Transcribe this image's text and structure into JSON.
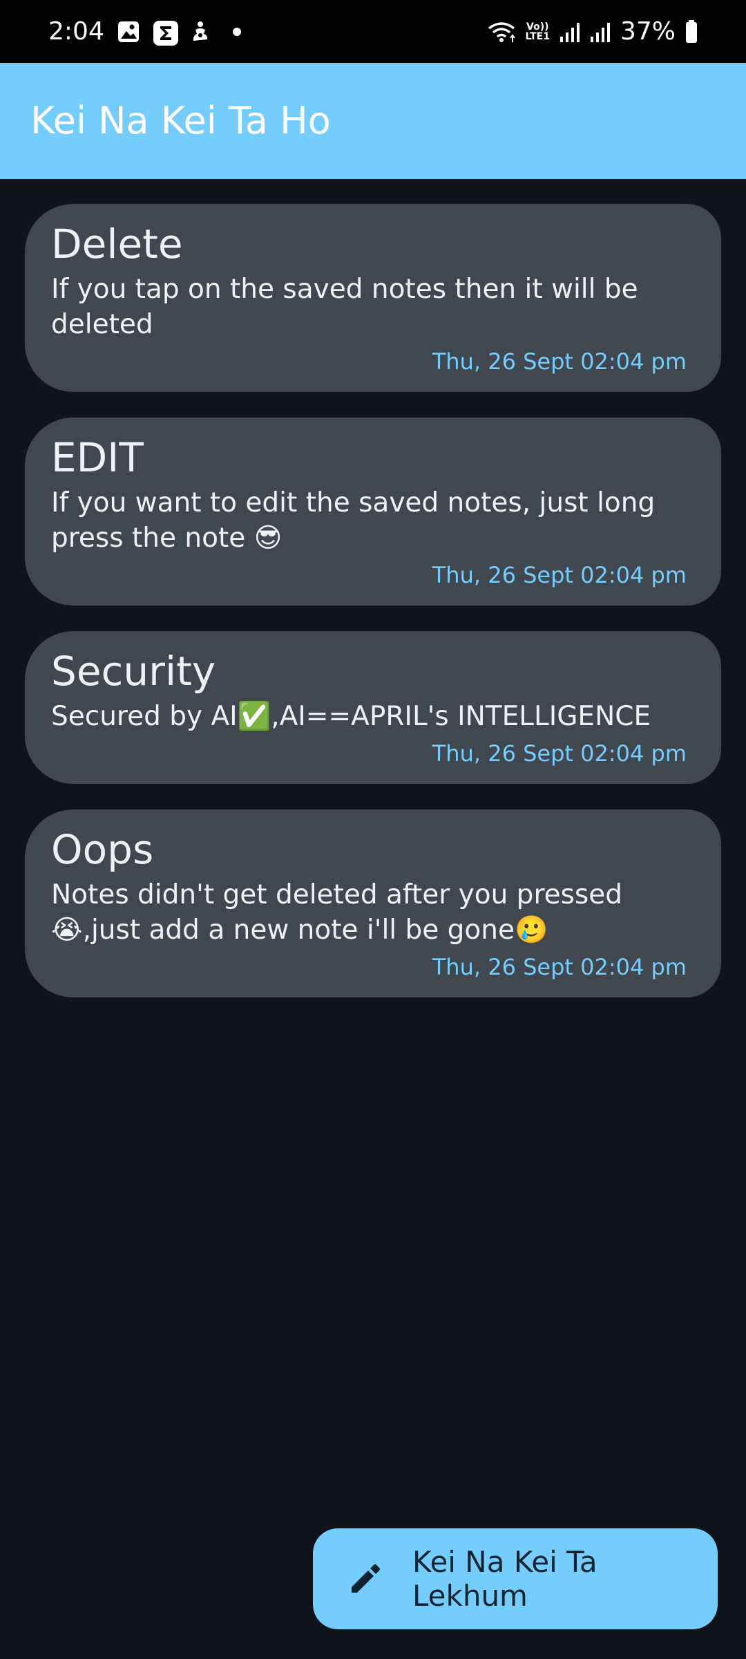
{
  "status_bar": {
    "time": "2:04",
    "battery_percent": "37%",
    "network_label_top": "Vo))",
    "network_label_bottom": "LTE1",
    "icons": [
      "gallery-icon",
      "sigma-app-icon",
      "figure-app-icon",
      "notification-dot",
      "wifi-icon",
      "volte-icon",
      "signal-icon",
      "signal-icon",
      "battery-icon"
    ]
  },
  "app_bar": {
    "title": "Kei Na Kei Ta Ho",
    "color": "#74cdfc"
  },
  "notes": [
    {
      "title": "Delete",
      "body": "If you tap on the saved notes then it will be deleted",
      "date": "Thu, 26 Sept 02:04 pm"
    },
    {
      "title": "EDIT",
      "body": "If you want to edit the saved notes, just long press the note 😎",
      "date": "Thu, 26 Sept 02:04 pm"
    },
    {
      "title": "Security",
      "body": "Secured by AI✅,AI==APRIL's INTELLIGENCE",
      "date": "Thu, 26 Sept 02:04 pm"
    },
    {
      "title": "Oops",
      "body": "Notes didn't get deleted after you pressed😭,just add a new note i'll be gone🥲",
      "date": "Thu, 26 Sept 02:04 pm"
    }
  ],
  "fab": {
    "label": "Kei Na Kei Ta Lekhum",
    "icon": "pencil-icon"
  },
  "colors": {
    "background": "#0f141a",
    "card": "#41474f",
    "accent": "#74cdfc",
    "text": "#eef2f6"
  }
}
